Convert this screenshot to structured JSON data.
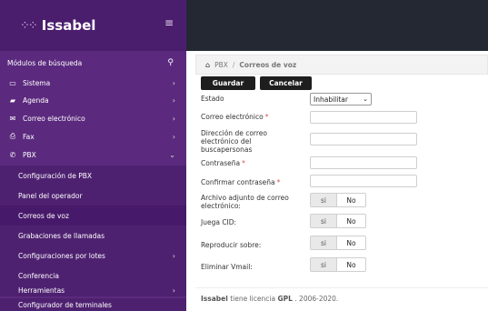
{
  "brand": {
    "name": "Issabel"
  },
  "sidebar": {
    "search_label": "Módulos de búsqueda",
    "items": [
      {
        "label": "Sistema",
        "icon": "monitor-icon"
      },
      {
        "label": "Agenda",
        "icon": "book-icon"
      },
      {
        "label": "Correo electrónico",
        "icon": "envelope-icon"
      },
      {
        "label": "Fax",
        "icon": "printer-icon"
      },
      {
        "label": "PBX",
        "icon": "phone-icon"
      }
    ],
    "subitems": [
      {
        "label": "Configuración de PBX"
      },
      {
        "label": "Panel del operador"
      },
      {
        "label": "Correos de voz"
      },
      {
        "label": "Grabaciones de llamadas"
      },
      {
        "label": "Configuraciones por lotes"
      },
      {
        "label": "Conferencia"
      },
      {
        "label": "Herramientas"
      },
      {
        "label": "Configurador de terminales"
      }
    ]
  },
  "breadcrumb": {
    "section": "PBX",
    "separator": "/",
    "current": "Correos de voz"
  },
  "toolbar": {
    "save_label": "Guardar",
    "cancel_label": "Cancelar"
  },
  "form": {
    "estado_label": "Estado",
    "estado_value": "Inhabilitar",
    "email_label": "Correo electrónico",
    "pager_label_1": "Dirección de correo",
    "pager_label_2": "electrónico del",
    "pager_label_3": "buscapersonas",
    "password_label": "Contraseña",
    "confirm_label": "Confirmar contraseña",
    "required_mark": "*",
    "attach_label_1": "Archivo adjunto de correo",
    "attach_label_2": "electrónico:",
    "cid_label": "Juega CID:",
    "play_label": "Reproducir sobre:",
    "delete_label": "Eliminar Vmail:",
    "yes": "si",
    "no": "No"
  },
  "footer": {
    "brand": "Issabel",
    "text1": "tiene licencia",
    "license": "GPL",
    "text2": ". 2006-2020."
  }
}
